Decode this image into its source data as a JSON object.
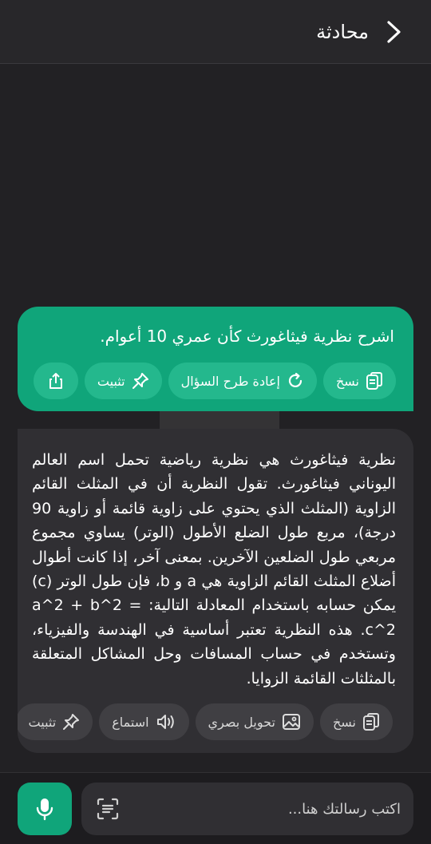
{
  "header": {
    "title": "محادثة",
    "back_icon": "chevron-right-icon"
  },
  "colors": {
    "accent": "#10a57a",
    "background": "#222124",
    "assistant_bubble": "#302f33"
  },
  "user_message": {
    "text": "اشرح نظرية فيثاغورث كأن عمري 10 أعوام.",
    "actions": [
      {
        "label": "نسخ",
        "icon": "copy-icon"
      },
      {
        "label": "إعادة طرح السؤال",
        "icon": "refresh-icon"
      },
      {
        "label": "تثبيت",
        "icon": "pin-icon"
      },
      {
        "label": "",
        "icon": "share-icon"
      }
    ]
  },
  "assistant_message": {
    "text": "نظرية فيثاغورث هي نظرية رياضية تحمل اسم العالم اليوناني فيثاغورث. تقول النظرية أن في المثلث القائم الزاوية (المثلث الذي يحتوي على زاوية قائمة أو زاوية 90 درجة)، مربع طول الضلع الأطول (الوتر) يساوي مجموع مربعي طول الضلعين الآخرين. بمعنى آخر، إذا كانت أطوال أضلاع المثلث القائم الزاوية هي a و b، فإن طول الوتر (c) يمكن حسابه باستخدام المعادلة التالية: a^2 + b^2 = c^2. هذه النظرية تعتبر أساسية في الهندسة والفيزياء، وتستخدم في حساب المسافات وحل المشاكل المتعلقة بالمثلثات القائمة الزوايا.",
    "actions": [
      {
        "label": "نسخ",
        "icon": "copy-icon"
      },
      {
        "label": "تحويل بصري",
        "icon": "image-icon"
      },
      {
        "label": "استماع",
        "icon": "speaker-icon"
      },
      {
        "label": "تثبيت",
        "icon": "pin-icon"
      }
    ]
  },
  "composer": {
    "placeholder": "اكتب رسالتك هنا...",
    "mic_icon": "microphone-icon",
    "scan_icon": "scan-text-icon"
  }
}
